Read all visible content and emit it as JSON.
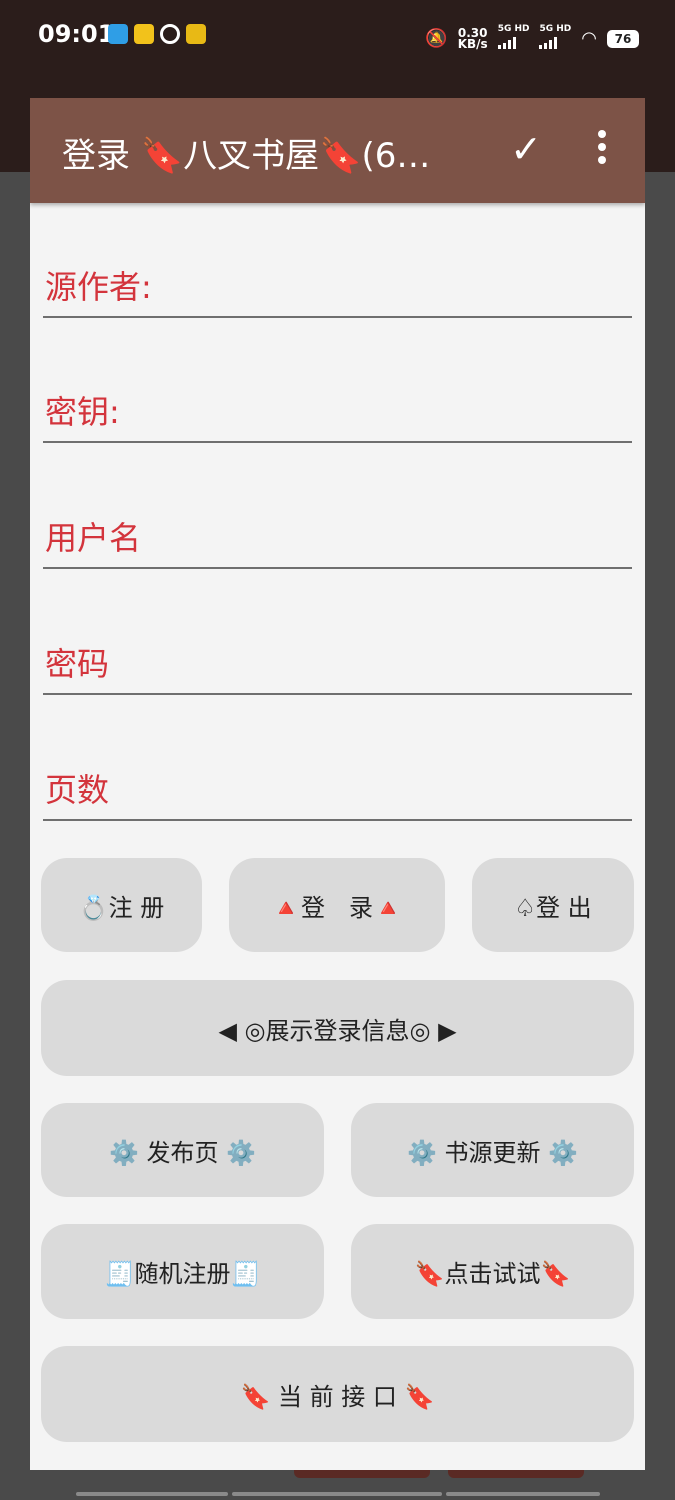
{
  "status": {
    "time": "09:01",
    "speed_value": "0.30",
    "speed_unit": "KB/s",
    "sig1": "5G HD",
    "sig2": "5G HD",
    "battery": "76"
  },
  "toolbar": {
    "title": "登录 🔖八叉书屋🔖(6…",
    "confirm_icon": "✓",
    "more_icon": "more-vert-icon"
  },
  "fields": [
    {
      "label": "源作者:"
    },
    {
      "label": "密钥:"
    },
    {
      "label": "用户名"
    },
    {
      "label": "密码"
    },
    {
      "label": "页数"
    }
  ],
  "buttons": {
    "register": "💍注 册",
    "login": "🔺登　录🔺",
    "logout": "♤登 出",
    "show_info": "◀ ◎展示登录信息◎ ▶",
    "publish": "⚙️ 发布页 ⚙️",
    "update_source": "⚙️ 书源更新 ⚙️",
    "random_register": "🧾随机注册🧾",
    "try_it": "🔖点击试试🔖",
    "current_api": "🔖 当 前 接 口 🔖"
  },
  "colors": {
    "toolbar": "#7d5347",
    "label": "#d3343c",
    "button_bg": "#dadada",
    "dialog_bg": "#f4f4f4"
  }
}
